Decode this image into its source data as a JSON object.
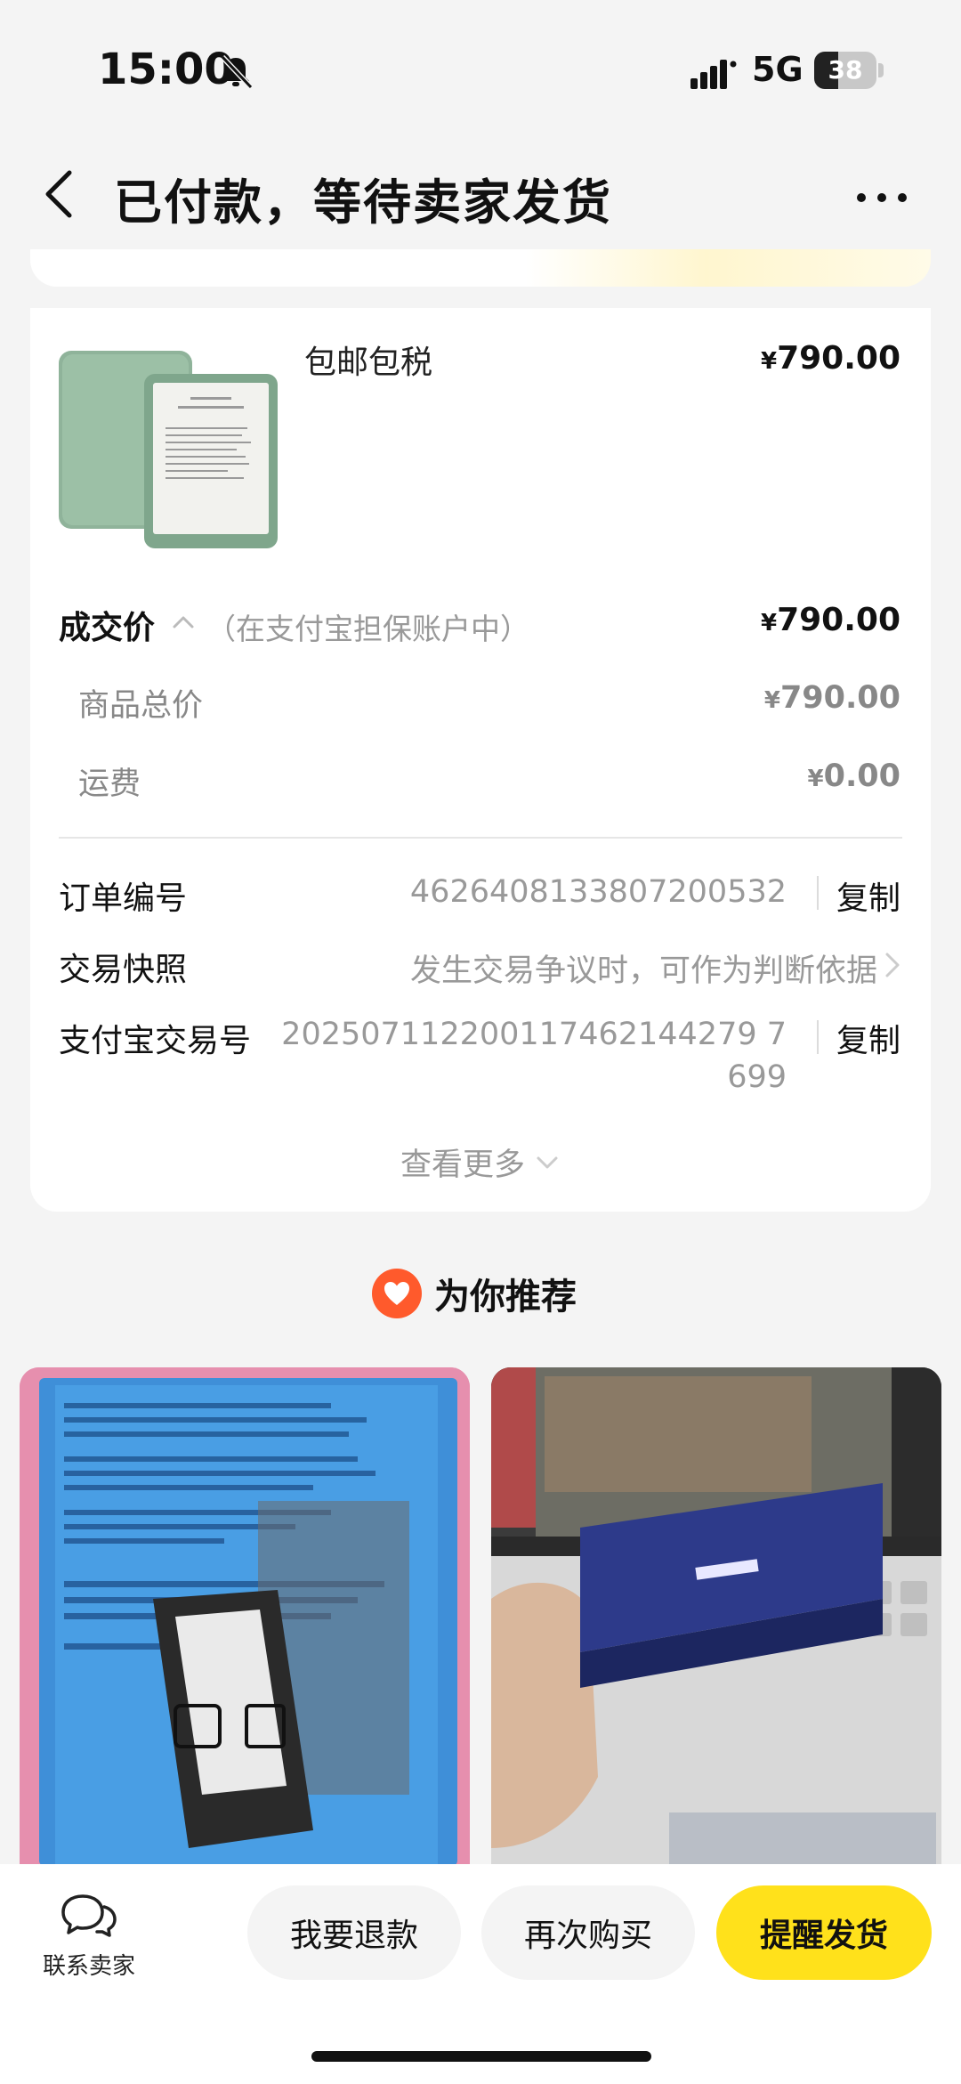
{
  "status_bar": {
    "time": "15:00",
    "network": "5G",
    "battery_level": "38",
    "battery_fraction": 0.38
  },
  "header": {
    "title": "已付款，等待卖家发货"
  },
  "product": {
    "title": "包邮包税",
    "price_symbol": "¥",
    "price": "790.00"
  },
  "deal": {
    "label": "成交价",
    "note": "（在支付宝担保账户中）",
    "price_symbol": "¥",
    "price": "790.00",
    "goods_total_label": "商品总价",
    "goods_total_symbol": "¥",
    "goods_total": "790.00",
    "shipping_label": "运费",
    "shipping_symbol": "¥",
    "shipping": "0.00"
  },
  "order_info": {
    "order_no_label": "订单编号",
    "order_no": "4626408133807200532",
    "copy_label": "复制",
    "snapshot_label": "交易快照",
    "snapshot_value": "发生交易争议时，可作为判断依据",
    "alipay_label": "支付宝交易号",
    "alipay_no_line1": "202507112200117462144279 7",
    "alipay_no_line2": "699",
    "see_more": "查看更多"
  },
  "recommend": {
    "title": "为你推荐"
  },
  "bottom_bar": {
    "contact_label": "联系卖家",
    "refund_label": "我要退款",
    "rebuy_label": "再次购买",
    "remind_label": "提醒发货"
  },
  "colors": {
    "accent_yellow": "#ffe11b",
    "heart_orange": "#ff5a2c",
    "background": "#f4f4f4"
  }
}
